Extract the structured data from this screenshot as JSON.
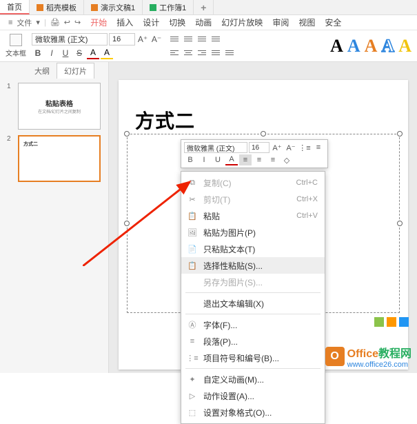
{
  "doc_tabs": {
    "home": "首页",
    "t1": "稻壳模板",
    "t2": "演示文稿1",
    "t3": "工作簿1"
  },
  "menu": {
    "file": "文件",
    "start": "开始",
    "insert": "插入",
    "design": "设计",
    "transition": "切换",
    "anim": "动画",
    "slideshow": "幻灯片放映",
    "review": "审阅",
    "view": "视图",
    "security": "安全"
  },
  "ribbon": {
    "textbox_label": "文本框",
    "font_name": "微软雅黑 (正文)",
    "font_size": "16",
    "btn": {
      "b": "B",
      "i": "I",
      "u": "U",
      "s": "S",
      "a_font": "A",
      "a_color": "A"
    }
  },
  "wordart": {
    "a": "A"
  },
  "wordart_colors": [
    "#000000",
    "#2e86de",
    "#e67e22",
    "#2e86de",
    "#f1c40f"
  ],
  "side": {
    "tab_outline": "大纲",
    "tab_slides": "幻灯片"
  },
  "thumbs": {
    "s1_num": "1",
    "s1_title": "粘贴表格",
    "s1_sub": "在文档/幻灯片之间复制",
    "s2_num": "2",
    "s2_title": "方式二"
  },
  "slide": {
    "title": "方式二"
  },
  "mini": {
    "font_name": "微软雅黑 (正文)",
    "font_size": "16",
    "b": "B",
    "i": "I",
    "u": "U",
    "a": "A"
  },
  "ctx": {
    "copy": "复制(C)",
    "copy_sc": "Ctrl+C",
    "cut": "剪切(T)",
    "cut_sc": "Ctrl+X",
    "paste": "粘贴",
    "paste_sc": "Ctrl+V",
    "paste_pic": "粘贴为图片(P)",
    "paste_text": "只粘贴文本(T)",
    "paste_special": "选择性粘贴(S)...",
    "save_as_pic": "另存为图片(S)...",
    "exit_edit": "退出文本编辑(X)",
    "font": "字体(F)...",
    "paragraph": "段落(P)...",
    "bullets": "项目符号和编号(B)...",
    "custom_anim": "自定义动画(M)...",
    "action": "动作设置(A)...",
    "format": "设置对象格式(O)..."
  },
  "watermark": {
    "brand": "Office",
    "brand_cn": "教程网",
    "url": "www.office26.com"
  }
}
